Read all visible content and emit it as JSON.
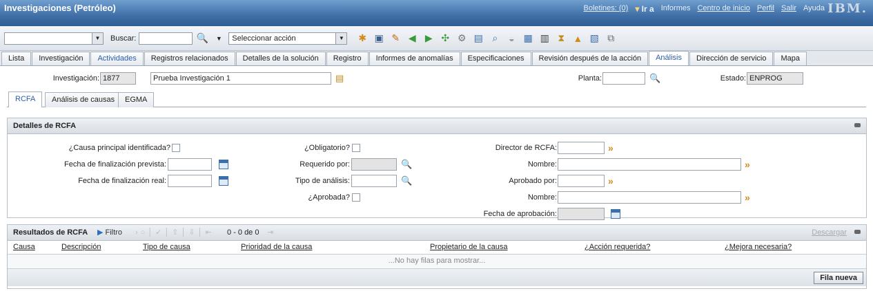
{
  "app": {
    "title": "Investigaciones (Petróleo)",
    "links": [
      "Boletines: (0)",
      "Ir a",
      "Informes",
      "Centro de inicio",
      "Perfil",
      "Salir",
      "Ayuda"
    ],
    "logo": "IBM."
  },
  "toolbar": {
    "search_label": "Buscar:",
    "action_placeholder": "Seleccionar acción"
  },
  "main_tabs": [
    "Lista",
    "Investigación",
    "Actividades",
    "Registros relacionados",
    "Detalles de la solución",
    "Registro",
    "Informes de anomalías",
    "Especificaciones",
    "Revisión después de la acción",
    "Análisis",
    "Dirección de servicio",
    "Mapa"
  ],
  "active_main_tab": "Análisis",
  "header": {
    "investigation_label": "Investigación:",
    "investigation_id": "1877",
    "description": "Prueba Investigación 1",
    "plant_label": "Planta:",
    "status_label": "Estado:",
    "status_value": "ENPROG"
  },
  "sub_tabs": [
    "RCFA",
    "Análisis de causas",
    "EGMA"
  ],
  "rcfa": {
    "section_title": "Detalles de RCFA",
    "root_cause_label": "¿Causa principal identificada?",
    "planned_end_label": "Fecha de finalización prevista:",
    "actual_end_label": "Fecha de finalización real:",
    "mandatory_label": "¿Obligatorio?",
    "required_by_label": "Requerido por:",
    "analysis_type_label": "Tipo de análisis:",
    "approved_q_label": "¿Aprobada?",
    "director_label": "Director de RCFA:",
    "name_label_1": "Nombre:",
    "approved_by_label": "Aprobado por:",
    "name_label_2": "Nombre:",
    "approval_date_label": "Fecha de aprobación:"
  },
  "results": {
    "title": "Resultados de RCFA",
    "filter_label": "Filtro",
    "count": "0 - 0 de 0",
    "download_label": "Descargar",
    "columns": [
      "Causa",
      "Descripción",
      "Tipo de causa",
      "Prioridad de la causa",
      "Propietario de la causa",
      "¿Acción requerida?",
      "¿Mejora necesaria?"
    ],
    "empty_text": "...No hay filas para mostrar...",
    "new_row_label": "Fila nueva"
  },
  "colors": {
    "title_bar": "#3f6fa6",
    "accent": "#2a5ea8",
    "arrow_orange": "#d58a1a"
  }
}
